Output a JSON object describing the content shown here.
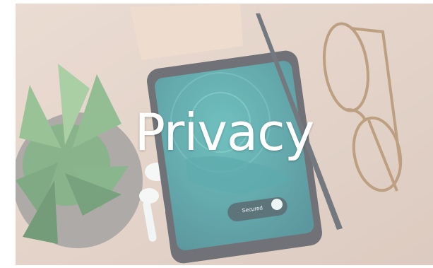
{
  "title": "Privacy",
  "phone": {
    "status_label": "Secured"
  },
  "colors": {
    "table": "#d9c6b9",
    "phone_screen": "#2a8f93",
    "plant": "#5f9a63",
    "note": "#e6cdb8",
    "overlay": "#ffffff"
  }
}
